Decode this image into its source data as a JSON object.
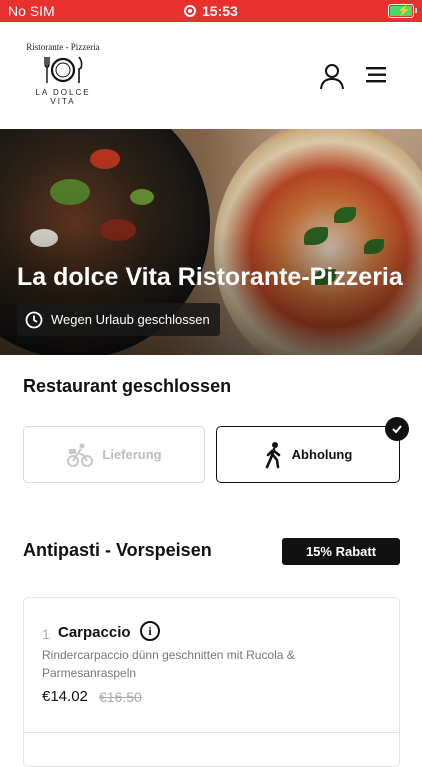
{
  "status_bar": {
    "carrier": "No SIM",
    "time": "15:53"
  },
  "brand": {
    "tagline": "Ristorante - Pizzeria",
    "name": "LA DOLCE VITA"
  },
  "hero": {
    "title": "La dolce Vita Ristorante-Pizzeria",
    "badge": "Wegen Urlaub geschlossen"
  },
  "restaurant_status": "Restaurant geschlossen",
  "order_options": [
    {
      "label": "Lieferung",
      "selected": false,
      "icon": "bicycle-icon"
    },
    {
      "label": "Abholung",
      "selected": true,
      "icon": "walking-icon"
    }
  ],
  "section": {
    "title": "Antipasti - Vorspeisen",
    "discount": "15% Rabatt"
  },
  "menu_items": [
    {
      "qty": "1",
      "name": "Carpaccio",
      "description": "Rindercarpaccio dünn geschnitten mit Rucola & Parmesanraspeln",
      "price": "€14.02",
      "old_price": "€16.50"
    }
  ],
  "colors": {
    "status_bar": "#e8302f",
    "text": "#111111",
    "muted": "#bdbdbd",
    "battery": "#4cd964"
  }
}
